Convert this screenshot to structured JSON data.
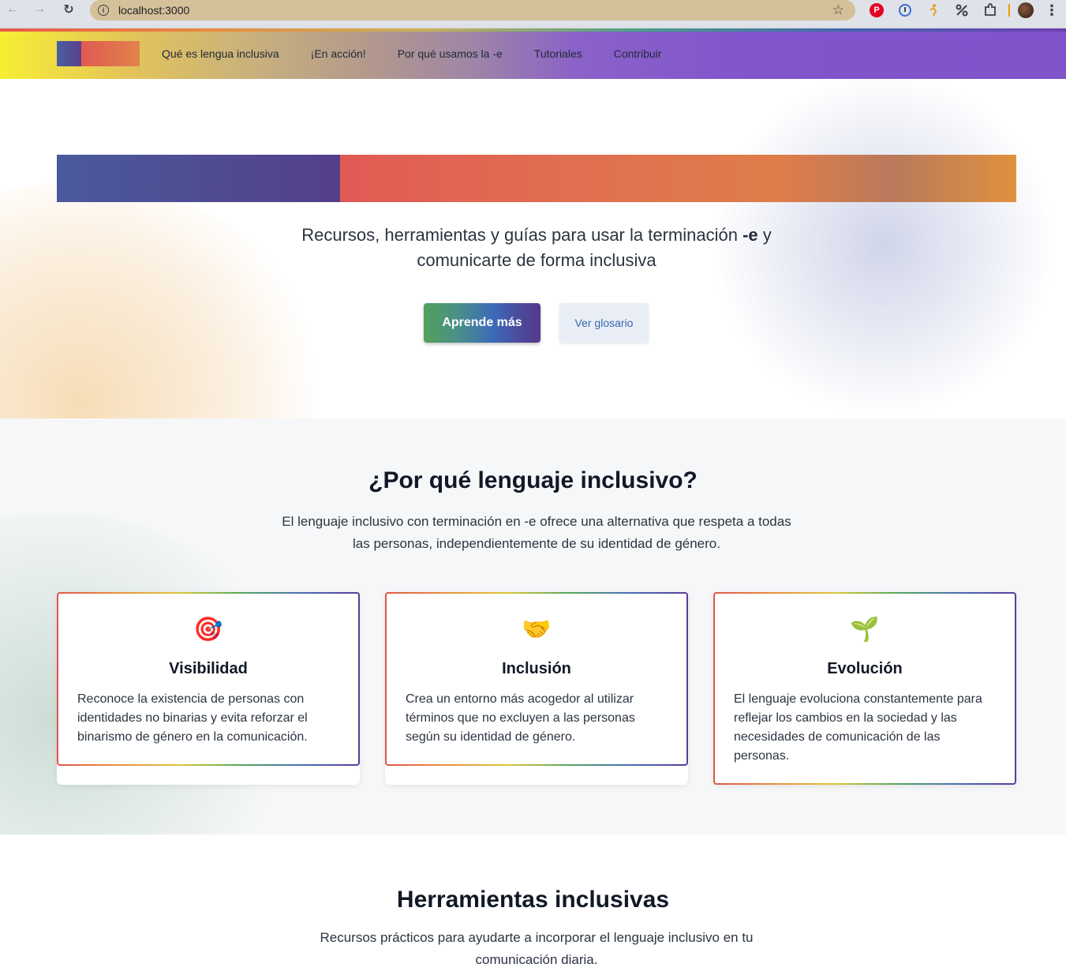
{
  "browser": {
    "url": "localhost:3000",
    "back_icon": "←",
    "forward_icon": "→",
    "reload_icon": "↻",
    "info_icon": "i",
    "star_icon": "☆",
    "extensions": [
      "pinterest-icon",
      "onepassword-icon",
      "runner-icon",
      "percent-icon",
      "puzzle-icon",
      "avatar-icon"
    ]
  },
  "header": {
    "nav": [
      {
        "label": "Qué es lengua inclusiva"
      },
      {
        "label": "¡En acción!"
      },
      {
        "label": "Por qué usamos la -e"
      },
      {
        "label": "Tutoriales"
      },
      {
        "label": "Contribuir"
      }
    ]
  },
  "hero": {
    "subtitle_before": "Recursos, herramientas y guías para usar la terminación ",
    "subtitle_bold": "-e",
    "subtitle_after": " y comunicarte de forma inclusiva",
    "primary_button": "Aprende más",
    "secondary_button": "Ver glosario"
  },
  "why": {
    "title": "¿Por qué lenguaje inclusivo?",
    "description": "El lenguaje inclusivo con terminación en -e ofrece una alternativa que respeta a todas las personas, independientemente de su identidad de género.",
    "cards": [
      {
        "emoji": "🎯",
        "icon_name": "target-icon",
        "title": "Visibilidad",
        "text": "Reconoce la existencia de personas con identidades no binarias y evita reforzar el binarismo de género en la comunicación."
      },
      {
        "emoji": "🤝",
        "icon_name": "handshake-icon",
        "title": "Inclusión",
        "text": "Crea un entorno más acogedor al utilizar términos que no excluyen a las personas según su identidad de género."
      },
      {
        "emoji": "🌱",
        "icon_name": "seedling-icon",
        "title": "Evolución",
        "text": "El lenguaje evoluciona constantemente para reflejar los cambios en la sociedad y las necesidades de comunicación de las personas."
      }
    ]
  },
  "tools": {
    "title": "Herramientas inclusivas",
    "description": "Recursos prácticos para ayudarte a incorporar el lenguaje inclusivo en tu comunicación diaria."
  },
  "colors": {
    "header_start": "#f7ee33",
    "header_end": "#8053cb",
    "link_blue": "#3a66b0",
    "text_dark": "#111827"
  }
}
